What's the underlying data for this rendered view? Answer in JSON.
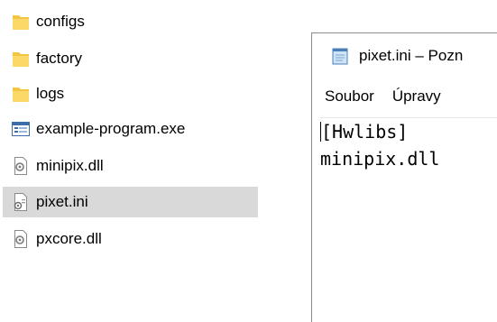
{
  "explorer": {
    "items": [
      {
        "label": "configs",
        "icon": "folder-icon"
      },
      {
        "label": "factory",
        "icon": "folder-icon"
      },
      {
        "label": "logs",
        "icon": "folder-icon"
      },
      {
        "label": "example-program.exe",
        "icon": "exe-icon"
      },
      {
        "label": "minipix.dll",
        "icon": "dll-icon"
      },
      {
        "label": "pixet.ini",
        "icon": "ini-icon",
        "selected": true
      },
      {
        "label": "pxcore.dll",
        "icon": "dll-icon"
      }
    ]
  },
  "notepad": {
    "title": "pixet.ini – Pozn",
    "menu": [
      "Soubor",
      "Úpravy"
    ],
    "lines": [
      "[Hwlibs]",
      "minipix.dll"
    ]
  },
  "colors": {
    "folder": "#f4c542",
    "selection": "#d9d9d9"
  }
}
